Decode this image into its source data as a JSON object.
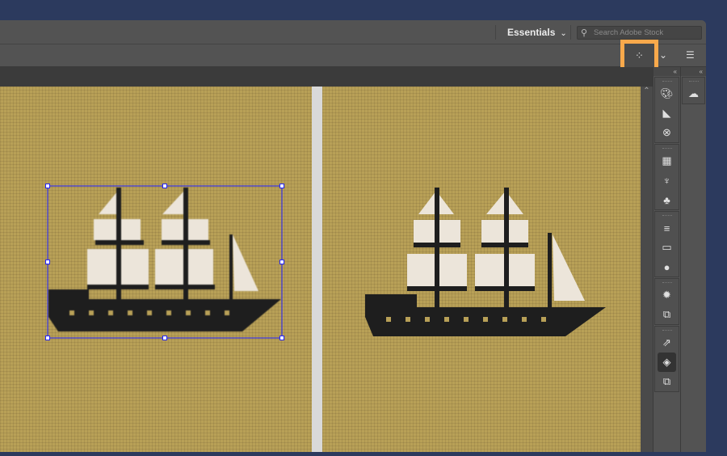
{
  "header": {
    "workspace": "Essentials",
    "search_placeholder": "Search Adobe Stock"
  },
  "toolbar": {
    "highlighted_icon": "arrange-documents-icon"
  },
  "panels": {
    "column1": [
      [
        "palette-icon",
        "gradient-swatch-icon",
        "color-guide-icon"
      ],
      [
        "swatches-icon",
        "brushes-icon",
        "symbols-icon"
      ],
      [
        "stroke-icon",
        "gradient-icon",
        "transparency-icon"
      ],
      [
        "appearance-icon",
        "graphic-styles-icon"
      ],
      [
        "export-icon",
        "layers-icon",
        "artboards-icon"
      ]
    ],
    "column2": [
      "creative-cloud-libraries-icon"
    ]
  },
  "colors": {
    "canvas": "#b8a057",
    "highlight": "#f9a94b",
    "selection": "#2222ff",
    "ship": "#1e1e1e",
    "sail": "#ece5da"
  }
}
